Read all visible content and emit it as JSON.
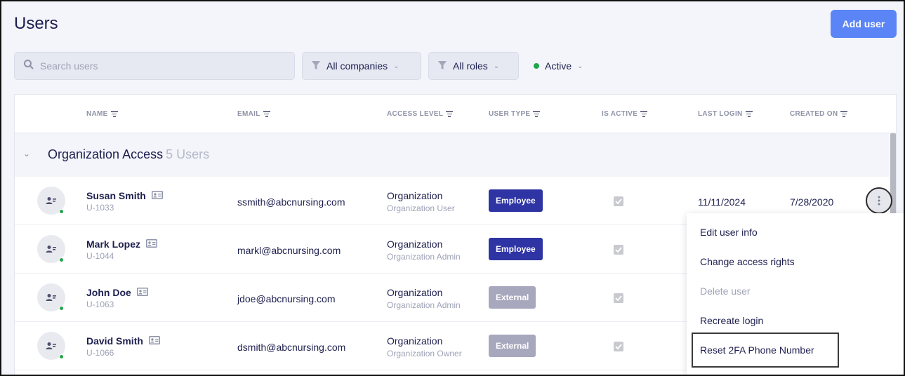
{
  "header": {
    "title": "Users",
    "add_button": "Add user"
  },
  "toolbar": {
    "search_placeholder": "Search users",
    "companies_filter": "All companies",
    "roles_filter": "All roles",
    "status_filter": "Active"
  },
  "table": {
    "columns": [
      "NAME",
      "EMAIL",
      "ACCESS LEVEL",
      "USER TYPE",
      "IS ACTIVE",
      "LAST LOGIN",
      "CREATED ON"
    ],
    "group": {
      "title": "Organization Access",
      "count": "5 Users"
    },
    "rows": [
      {
        "name": "Susan Smith",
        "id": "U-1033",
        "email": "ssmith@abcnursing.com",
        "access": "Organization",
        "role": "Organization User",
        "type": "Employee",
        "is_active": true,
        "last_login": "11/11/2024",
        "created_on": "7/28/2020"
      },
      {
        "name": "Mark Lopez",
        "id": "U-1044",
        "email": "markl@abcnursing.com",
        "access": "Organization",
        "role": "Organization Admin",
        "type": "Employee",
        "is_active": true
      },
      {
        "name": "John Doe",
        "id": "U-1063",
        "email": "jdoe@abcnursing.com",
        "access": "Organization",
        "role": "Organization Admin",
        "type": "External",
        "is_active": true
      },
      {
        "name": "David Smith",
        "id": "U-1066",
        "email": "dsmith@abcnursing.com",
        "access": "Organization",
        "role": "Organization Owner",
        "type": "External",
        "is_active": true
      }
    ]
  },
  "context_menu": {
    "items": [
      {
        "label": "Edit user info",
        "disabled": false
      },
      {
        "label": "Change access rights",
        "disabled": false
      },
      {
        "label": "Delete user",
        "disabled": true
      },
      {
        "label": "Recreate login",
        "disabled": false
      },
      {
        "label": "Reset 2FA Phone Number",
        "disabled": false,
        "highlighted": true
      }
    ]
  },
  "colors": {
    "primary": "#5b85f6",
    "employee_badge": "#2e34a3",
    "external_badge": "#a7a7bd",
    "online": "#1fa64a"
  }
}
